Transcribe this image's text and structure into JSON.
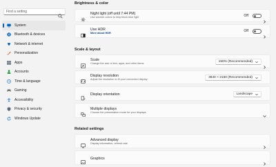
{
  "sidebar": {
    "search_placeholder": "Find a setting",
    "items": [
      {
        "label": "System",
        "icon": "monitor-icon",
        "color": "#0067c0",
        "active": true
      },
      {
        "label": "Bluetooth & devices",
        "icon": "bluetooth-icon",
        "color": "#0067c0"
      },
      {
        "label": "Network & internet",
        "icon": "network-icon",
        "color": "#0067c0"
      },
      {
        "label": "Personalization",
        "icon": "brush-icon",
        "color": "#c14b1d"
      },
      {
        "label": "Apps",
        "icon": "apps-icon",
        "color": "#4a5a6a"
      },
      {
        "label": "Accounts",
        "icon": "person-icon",
        "color": "#2a9d4a"
      },
      {
        "label": "Time & language",
        "icon": "globe-clock-icon",
        "color": "#0067c0"
      },
      {
        "label": "Gaming",
        "icon": "gamepad-icon",
        "color": "#6b6b6b"
      },
      {
        "label": "Accessibility",
        "icon": "accessibility-icon",
        "color": "#0067c0"
      },
      {
        "label": "Privacy & security",
        "icon": "shield-icon",
        "color": "#5a6b7a"
      },
      {
        "label": "Windows Update",
        "icon": "update-icon",
        "color": "#0067c0"
      }
    ]
  },
  "main": {
    "brightness_title": "Brightness & color",
    "night_light": {
      "title": "Night light (off until 7:44 PM)",
      "subtitle": "Use warmer colors to help block blue light",
      "state": "Off"
    },
    "hdr": {
      "title": "Use HDR",
      "subtitle": "More about HDR",
      "state": "Off"
    },
    "scale_title": "Scale & layout",
    "scale": {
      "title": "Scale",
      "subtitle": "Change the size of text, apps, and other items",
      "value": "150% (Recommended)"
    },
    "resolution": {
      "title": "Display resolution",
      "subtitle": "Adjust the resolution to fit your connected display",
      "value": "3840 × 2160 (Recommended)"
    },
    "orientation": {
      "title": "Display orientation",
      "value": "Landscape"
    },
    "multiple": {
      "title": "Multiple displays",
      "subtitle": "Choose the presentation mode for your displays"
    },
    "related_title": "Related settings",
    "advanced": {
      "title": "Advanced display",
      "subtitle": "Display information, refresh rate"
    },
    "graphics": {
      "title": "Graphics"
    }
  }
}
